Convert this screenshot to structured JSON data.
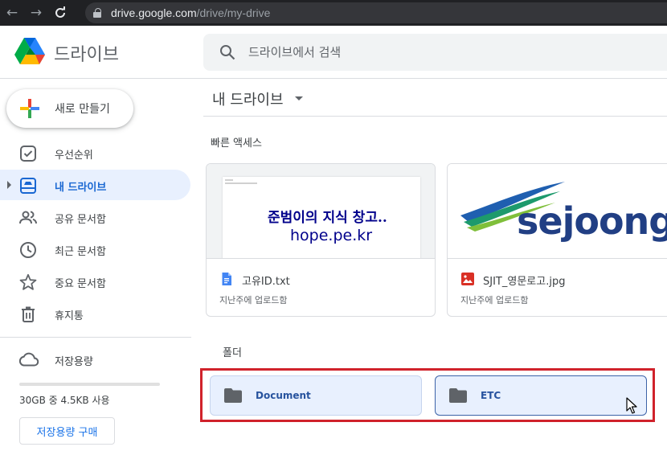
{
  "browser": {
    "url_host": "drive.google.com",
    "url_path": "/drive/my-drive"
  },
  "app": {
    "name": "드라이브",
    "search_placeholder": "드라이브에서 검색"
  },
  "sidebar": {
    "new_button": "새로 만들기",
    "items": [
      {
        "label": "우선순위",
        "icon": "check-box-icon",
        "active": false
      },
      {
        "label": "내 드라이브",
        "icon": "my-drive-icon",
        "active": true
      },
      {
        "label": "공유 문서함",
        "icon": "people-icon",
        "active": false
      },
      {
        "label": "최근 문서함",
        "icon": "clock-icon",
        "active": false
      },
      {
        "label": "중요 문서함",
        "icon": "star-icon",
        "active": false
      },
      {
        "label": "휴지통",
        "icon": "trash-icon",
        "active": false
      }
    ],
    "storage": {
      "label": "저장용량",
      "usage_text": "30GB 중 4.5KB 사용",
      "used_fraction": 0.0001,
      "buy_button": "저장용량 구매"
    }
  },
  "main": {
    "title": "내 드라이브",
    "quick_access_label": "빠른 액세스",
    "quick_access": [
      {
        "name": "고유ID.txt",
        "sub": "지난주에 업로드함",
        "icon": "google-doc-icon",
        "preview_line1": "준범이의 지식 창고..",
        "preview_line2": "hope.pe.kr"
      },
      {
        "name": "SJIT_영문로고.jpg",
        "sub": "지난주에 업로드함",
        "icon": "image-file-icon",
        "preview_logo_text": "sejoong"
      }
    ],
    "folders_label": "폴더",
    "folders": [
      {
        "name": "Document"
      },
      {
        "name": "ETC"
      }
    ]
  },
  "colors": {
    "accent": "#1a73e8",
    "active_bg": "#e8f0fe",
    "highlight_box": "#d0222b"
  }
}
